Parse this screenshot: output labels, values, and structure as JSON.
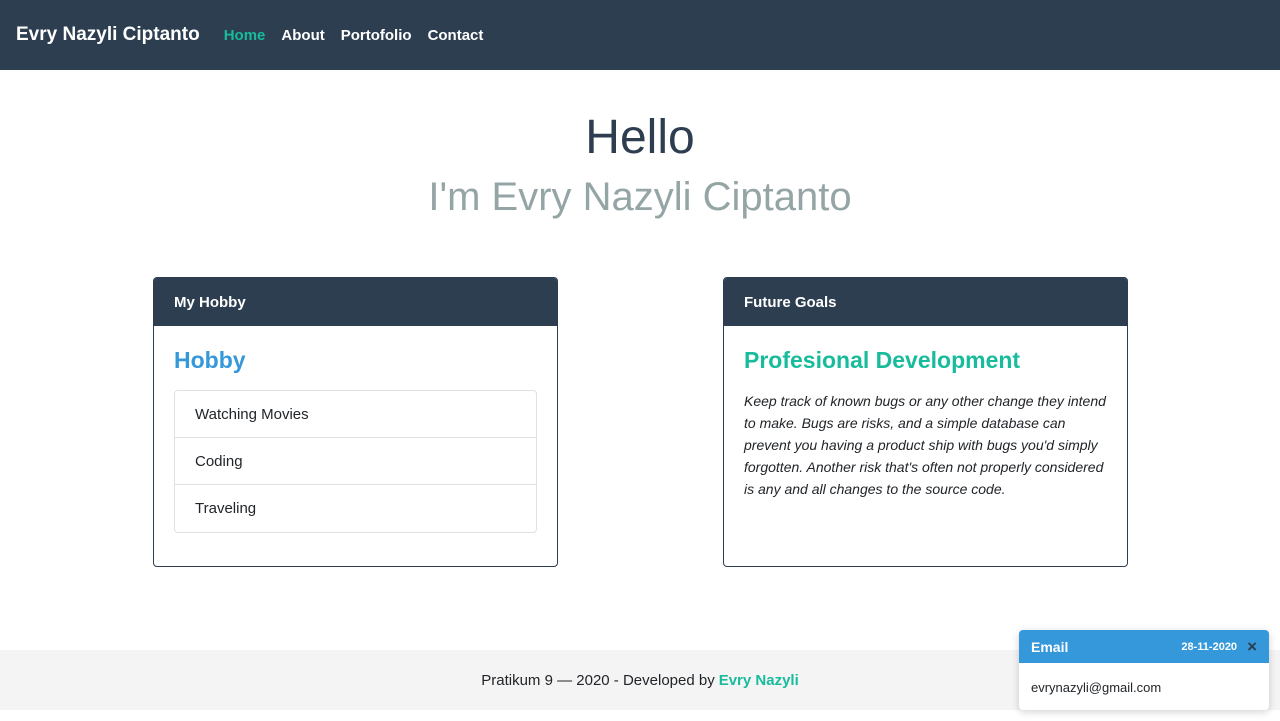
{
  "navbar": {
    "brand": "Evry Nazyli Ciptanto",
    "links": [
      {
        "label": "Home",
        "active": true
      },
      {
        "label": "About",
        "active": false
      },
      {
        "label": "Portofolio",
        "active": false
      },
      {
        "label": "Contact",
        "active": false
      }
    ]
  },
  "hero": {
    "title": "Hello",
    "subtitle": "I'm Evry Nazyli Ciptanto"
  },
  "hobby_card": {
    "header": "My Hobby",
    "title": "Hobby",
    "items": [
      "Watching Movies",
      "Coding",
      "Traveling"
    ]
  },
  "goals_card": {
    "header": "Future Goals",
    "title": "Profesional Development",
    "text": "Keep track of known bugs or any other change they intend to make. Bugs are risks, and a simple database can prevent you having a product ship with bugs you'd simply forgotten. Another risk that's often not properly considered is any and all changes to the source code."
  },
  "footer": {
    "text": "Pratikum 9 — 2020 - Developed by",
    "author": "Evry Nazyli"
  },
  "toast": {
    "title": "Email",
    "date": "28-11-2020",
    "close_icon": "×",
    "body": "evrynazyli@gmail.com"
  },
  "colors": {
    "primary": "#2c3e50",
    "success": "#18bc9c",
    "info": "#3498db",
    "muted": "#95a5a6"
  }
}
